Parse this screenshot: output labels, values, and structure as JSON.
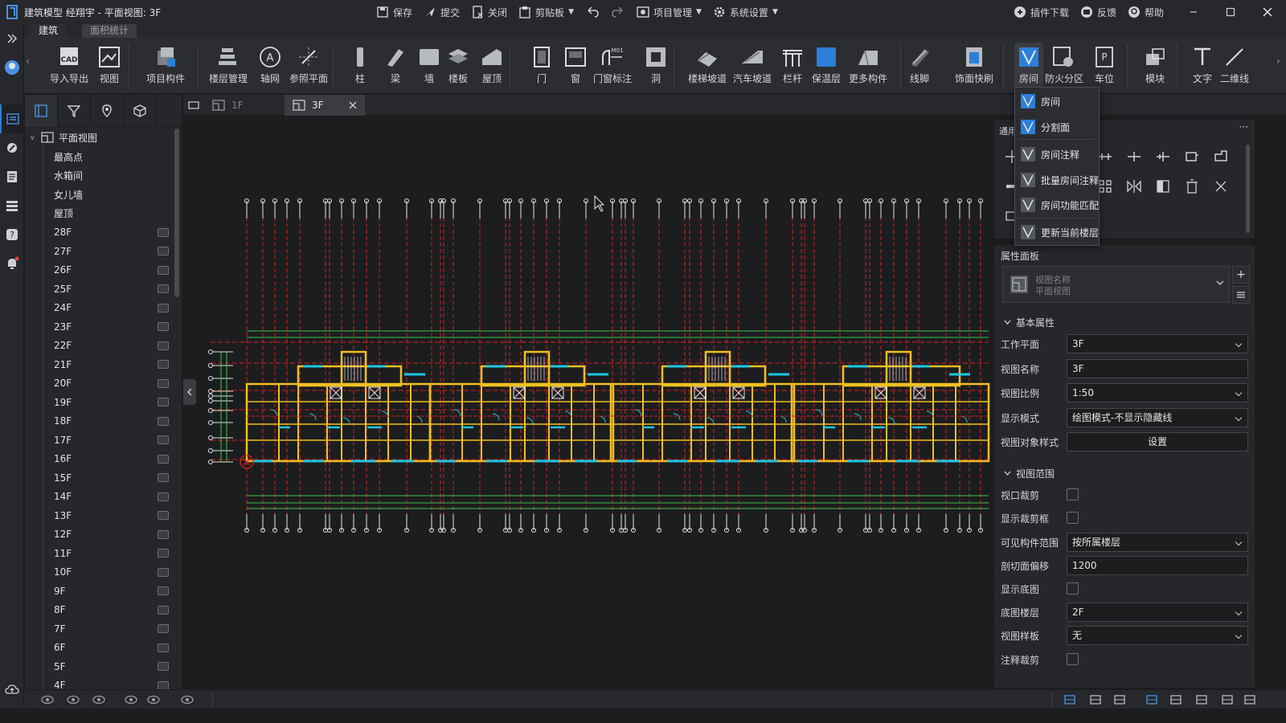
{
  "window": {
    "title": "建筑模型 经翔宇 - 平面视图: 3F"
  },
  "titlebar": {
    "center_buttons": [
      {
        "label": "保存",
        "icon": "save-icon"
      },
      {
        "label": "提交",
        "icon": "submit-icon"
      },
      {
        "label": "关闭",
        "icon": "close-file-icon"
      },
      {
        "label": "剪贴板",
        "icon": "clipboard-icon"
      },
      {
        "label": "项目管理",
        "icon": "project-icon"
      },
      {
        "label": "系统设置",
        "icon": "gear-icon"
      }
    ],
    "right_buttons": [
      {
        "label": "插件下载",
        "icon": "plugin-icon"
      },
      {
        "label": "反馈",
        "icon": "feedback-icon"
      },
      {
        "label": "帮助",
        "icon": "help-icon"
      }
    ]
  },
  "ribbon": {
    "tabs": [
      {
        "label": "建筑",
        "active": true
      },
      {
        "label": "面积统计",
        "active": false
      }
    ],
    "buttons": [
      "导入导出",
      "视图",
      "项目构件",
      "楼层管理",
      "轴网",
      "参照平面",
      "柱",
      "梁",
      "墙",
      "楼板",
      "屋顶",
      "门",
      "窗",
      "门窗标注",
      "洞",
      "楼梯坡道",
      "汽车坡道",
      "栏杆",
      "保温层",
      "更多构件",
      "线脚",
      "饰面快刷",
      "房间",
      "防火分区",
      "车位",
      "模块",
      "文字",
      "二维线"
    ]
  },
  "tree": {
    "root": "平面视图",
    "items": [
      "最高点",
      "水箱间",
      "女儿墙",
      "屋顶",
      "28F",
      "27F",
      "26F",
      "25F",
      "24F",
      "23F",
      "22F",
      "21F",
      "20F",
      "19F",
      "18F",
      "17F",
      "16F",
      "15F",
      "14F",
      "13F",
      "12F",
      "11F",
      "10F",
      "9F",
      "8F",
      "7F",
      "6F",
      "5F",
      "4F"
    ]
  },
  "doc_tabs": [
    {
      "label": "1F",
      "active": false
    },
    {
      "label": "3F",
      "active": true
    }
  ],
  "dropdown": {
    "items": [
      "房间",
      "分割面",
      "房间注释",
      "批量房间注释",
      "房间功能匹配",
      "更新当前楼层"
    ]
  },
  "tool_panel": {
    "title": "通用"
  },
  "properties": {
    "title": "属性面板",
    "view_selector": {
      "line1": "视图名称",
      "line2": "平面视图"
    },
    "sections": {
      "basic": "基本属性",
      "range": "视图范围"
    },
    "basic": [
      {
        "label": "工作平面",
        "value": "3F",
        "type": "dropdown"
      },
      {
        "label": "视图名称",
        "value": "3F",
        "type": "text"
      },
      {
        "label": "视图比例",
        "value": "1:50",
        "type": "dropdown"
      },
      {
        "label": "显示模式",
        "value": "绘图模式-不显示隐藏线",
        "type": "dropdown"
      },
      {
        "label": "视图对象样式",
        "value": "设置",
        "type": "button"
      }
    ],
    "range": [
      {
        "label": "视口裁剪",
        "type": "checkbox"
      },
      {
        "label": "显示裁剪框",
        "type": "checkbox"
      },
      {
        "label": "可见构件范围",
        "value": "按所属楼层",
        "type": "dropdown"
      },
      {
        "label": "剖切面偏移",
        "value": "1200",
        "type": "text"
      },
      {
        "label": "显示底图",
        "type": "checkbox"
      },
      {
        "label": "底图楼层",
        "value": "2F",
        "type": "dropdown"
      },
      {
        "label": "视图样板",
        "value": "无",
        "type": "dropdown"
      },
      {
        "label": "注释裁剪",
        "type": "checkbox"
      }
    ]
  },
  "colors": {
    "accent": "#2b7fd9",
    "wall": "#f0c020",
    "axis": "#d81e1e",
    "window": "#19c7e6",
    "dim": "#3fc24a"
  }
}
